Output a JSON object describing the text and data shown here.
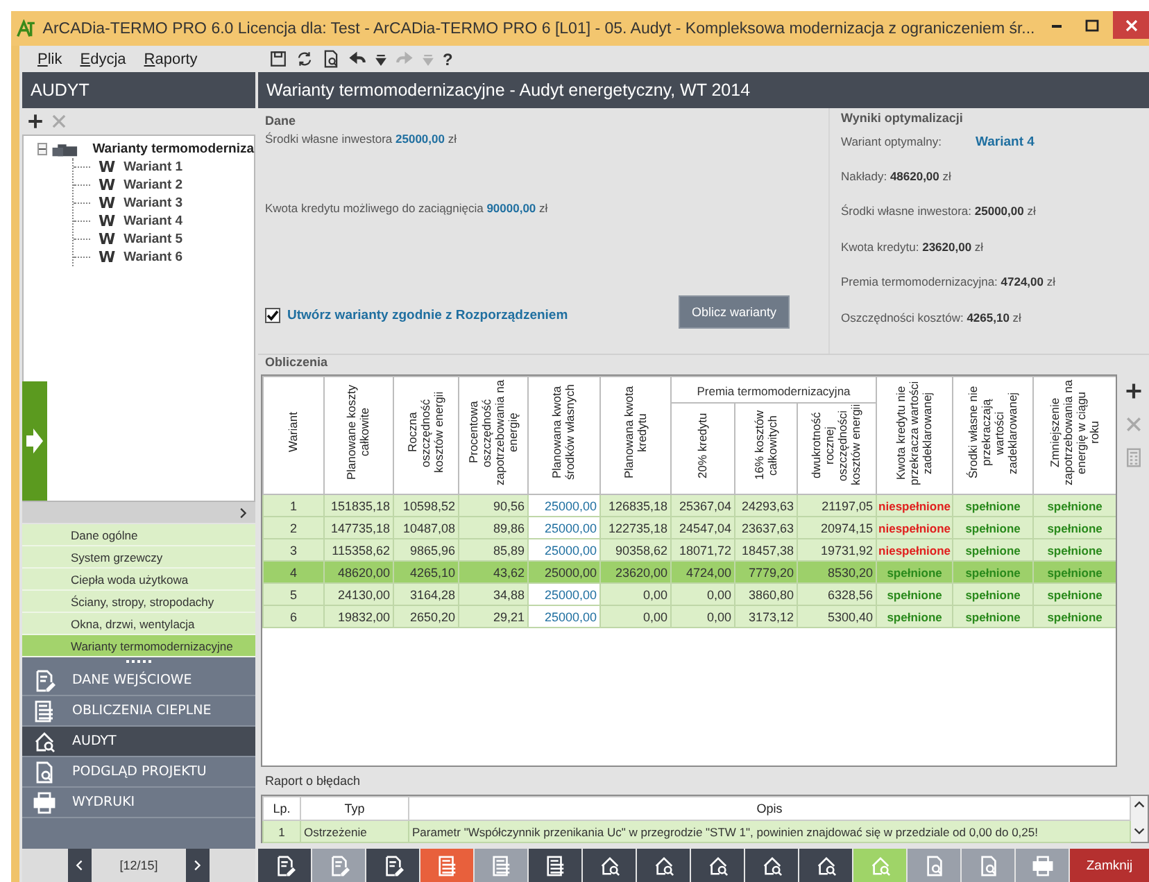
{
  "window": {
    "title": "ArCADia-TERMO PRO 6.0 Licencja dla: Test - ArCADia-TERMO PRO 6 [L01] - 05. Audyt - Kompleksowa modernizacja z ograniczeniem śr..."
  },
  "menu": [
    "Plik",
    "Edycja",
    "Raporty"
  ],
  "toolbar": [
    {
      "kind": "save",
      "disabled": false
    },
    {
      "kind": "refresh",
      "disabled": false
    },
    {
      "kind": "preview",
      "disabled": false
    },
    {
      "kind": "undo",
      "disabled": false
    },
    {
      "kind": "dropdown",
      "disabled": false
    },
    {
      "kind": "redo",
      "disabled": true
    },
    {
      "kind": "dropdown",
      "disabled": true
    },
    {
      "kind": "help",
      "label": "?",
      "disabled": false
    }
  ],
  "sidebar": {
    "title": "AUDYT",
    "tree_tools": [
      {
        "kind": "add",
        "disabled": false
      },
      {
        "kind": "remove",
        "disabled": true
      }
    ],
    "tree": {
      "label": "Warianty termomoderniza",
      "expanded": true,
      "children": [
        {
          "icon": "W",
          "label": "Wariant 1"
        },
        {
          "icon": "W",
          "label": "Wariant 2"
        },
        {
          "icon": "W",
          "label": "Wariant 3"
        },
        {
          "icon": "W",
          "label": "Wariant 4"
        },
        {
          "icon": "W",
          "label": "Wariant 5"
        },
        {
          "icon": "W",
          "label": "Wariant 6"
        }
      ]
    },
    "steps": [
      {
        "label": "Dane ogólne",
        "selected": false
      },
      {
        "label": "System grzewczy",
        "selected": false
      },
      {
        "label": "Ciepła woda użytkowa",
        "selected": false
      },
      {
        "label": "Ściany, stropy, stropodachy",
        "selected": false
      },
      {
        "label": "Okna, drzwi, wentylacja",
        "selected": false
      },
      {
        "label": "Warianty termomodernizacyjne",
        "selected": true
      }
    ],
    "nav": [
      {
        "kind": "input",
        "label": "DANE WEJŚCIOWE",
        "selected": false
      },
      {
        "kind": "calc",
        "label": "OBLICZENIA CIEPLNE",
        "selected": false
      },
      {
        "kind": "audit",
        "label": "AUDYT",
        "selected": true
      },
      {
        "kind": "preview",
        "label": "PODGLĄD PROJEKTU",
        "selected": false
      },
      {
        "kind": "print",
        "label": "WYDRUKI",
        "selected": false
      }
    ],
    "pager": "[12/15]"
  },
  "content": {
    "title": "Warianty termomodernizacyjne - Audyt energetyczny, WT 2014",
    "dane": {
      "title": "Dane",
      "fields": [
        "Środki własne inwestora **25000,00** zł",
        "Kwota kredytu możliwego do zaciągnięcia **90000,00** zł"
      ],
      "checkbox": {
        "label": "Utwórz warianty zgodnie z Rozporządzeniem",
        "checked": true
      },
      "button": "Oblicz warianty"
    },
    "wyniki": {
      "title": "Wyniki optymalizacji",
      "optimal_label": "Wariant optymalny:",
      "optimal_value": "Wariant 4",
      "lines": [
        "Nakłady: **48620,00** zł",
        "Środki własne inwestora: **25000,00** zł",
        "Kwota kredytu: **23620,00** zł",
        "Premia termomodernizacyjna: **4724,00** zł",
        "Oszczędności kosztów: **4265,10** zł"
      ]
    },
    "obliczenia": {
      "title": "Obliczenia",
      "columns": [
        {
          "kind": "single",
          "label": "Wariant"
        },
        {
          "kind": "single",
          "label": "Planowane koszty całkowite"
        },
        {
          "kind": "single",
          "label": "Roczna oszczędność kosztów energii"
        },
        {
          "kind": "single",
          "label": "Procentowa oszczędność zapotrzebowania na energię"
        },
        {
          "kind": "single",
          "label": "Planowana kwota środków własnych",
          "editable": true
        },
        {
          "kind": "single",
          "label": "Planowana kwota kredytu"
        },
        {
          "kind": "group",
          "label": "Premia termomodernizacyjna",
          "children": [
            {
              "label": "20% kredytu"
            },
            {
              "label": "16% kosztów całkowitych"
            },
            {
              "label": "dwukrotność rocznej oszczędności kosztów energii"
            }
          ]
        },
        {
          "kind": "single",
          "label": "Kwota kredytu nie przekracza wartości zadeklarowanej"
        },
        {
          "kind": "single",
          "label": "Środki własne nie przekraczają wartości zadeklarowanej"
        },
        {
          "kind": "single",
          "label": "Zmniejszenie zapotrzebowania na energię w ciągu roku"
        }
      ],
      "rows": [
        {
          "selected": false,
          "values": [
            "1",
            "151835,18",
            "10598,52",
            "90,56",
            "25000,00",
            "126835,18",
            "25367,04",
            "24293,63",
            "21197,05"
          ],
          "checks": [
            {
              "text": "niespełnione",
              "ok": false
            },
            {
              "text": "spełnione",
              "ok": true
            },
            {
              "text": "spełnione",
              "ok": true
            }
          ]
        },
        {
          "selected": false,
          "values": [
            "2",
            "147735,18",
            "10487,08",
            "89,86",
            "25000,00",
            "122735,18",
            "24547,04",
            "23637,63",
            "20974,15"
          ],
          "checks": [
            {
              "text": "niespełnione",
              "ok": false
            },
            {
              "text": "spełnione",
              "ok": true
            },
            {
              "text": "spełnione",
              "ok": true
            }
          ]
        },
        {
          "selected": false,
          "values": [
            "3",
            "115358,62",
            "9865,96",
            "85,89",
            "25000,00",
            "90358,62",
            "18071,72",
            "18457,38",
            "19731,92"
          ],
          "checks": [
            {
              "text": "niespełnione",
              "ok": false
            },
            {
              "text": "spełnione",
              "ok": true
            },
            {
              "text": "spełnione",
              "ok": true
            }
          ]
        },
        {
          "selected": true,
          "values": [
            "4",
            "48620,00",
            "4265,10",
            "43,62",
            "25000,00",
            "23620,00",
            "4724,00",
            "7779,20",
            "8530,20"
          ],
          "checks": [
            {
              "text": "spełnione",
              "ok": true
            },
            {
              "text": "spełnione",
              "ok": true
            },
            {
              "text": "spełnione",
              "ok": true
            }
          ]
        },
        {
          "selected": false,
          "values": [
            "5",
            "24130,00",
            "3164,28",
            "34,88",
            "25000,00",
            "0,00",
            "0,00",
            "3860,80",
            "6328,56"
          ],
          "checks": [
            {
              "text": "spełnione",
              "ok": true
            },
            {
              "text": "spełnione",
              "ok": true
            },
            {
              "text": "spełnione",
              "ok": true
            }
          ]
        },
        {
          "selected": false,
          "values": [
            "6",
            "19832,00",
            "2650,20",
            "29,21",
            "25000,00",
            "0,00",
            "0,00",
            "3173,12",
            "5300,40"
          ],
          "checks": [
            {
              "text": "spełnione",
              "ok": true
            },
            {
              "text": "spełnione",
              "ok": true
            },
            {
              "text": "spełnione",
              "ok": true
            }
          ]
        }
      ],
      "tools": [
        {
          "kind": "add",
          "disabled": false
        },
        {
          "kind": "remove",
          "disabled": true
        },
        {
          "kind": "calculator",
          "disabled": true
        }
      ]
    },
    "raport": {
      "title": "Raport o błędach",
      "columns": [
        "Lp.",
        "Typ",
        "Opis"
      ],
      "rows": [
        {
          "lp": "1",
          "typ": "Ostrzeżenie",
          "opis": "Parametr \"Współczynnik przenikania Uc\" w przegrodzie \"STW 1\", powinien znajdować się w przedziale od 0,00 do 0,25!"
        }
      ]
    }
  },
  "bottom_toolbar": [
    {
      "kind": "doc",
      "color": "#3f4550"
    },
    {
      "kind": "doc",
      "color": "#9aa0aa"
    },
    {
      "kind": "doc",
      "color": "#3f4550"
    },
    {
      "kind": "calc",
      "color": "#e8603c"
    },
    {
      "kind": "calc",
      "color": "#9aa0aa"
    },
    {
      "kind": "calc",
      "color": "#3f4550"
    },
    {
      "kind": "audit",
      "color": "#3f4550"
    },
    {
      "kind": "audit",
      "color": "#3f4550"
    },
    {
      "kind": "audit",
      "color": "#3f4550"
    },
    {
      "kind": "audit",
      "color": "#3f4550"
    },
    {
      "kind": "audit",
      "color": "#3f4550"
    },
    {
      "kind": "audit",
      "color": "#9fd468"
    },
    {
      "kind": "preview",
      "color": "#9aa0aa"
    },
    {
      "kind": "preview",
      "color": "#9aa0aa"
    },
    {
      "kind": "print",
      "color": "#9aa0aa"
    }
  ],
  "close_button": "Zamknij"
}
